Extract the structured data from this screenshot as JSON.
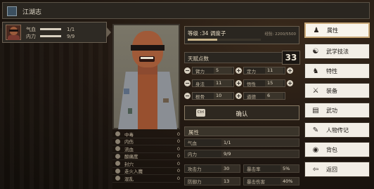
{
  "header": {
    "title": "江湖志"
  },
  "character_card": {
    "stats": [
      {
        "label": "气血",
        "value": "1/1"
      },
      {
        "label": "内力",
        "value": "9/9"
      }
    ]
  },
  "status_effects": [
    {
      "label": "中毒",
      "value": "0"
    },
    {
      "label": "内伤",
      "value": "0"
    },
    {
      "label": "流血",
      "value": "0"
    },
    {
      "label": "酸痛度",
      "value": "0"
    },
    {
      "label": "封穴",
      "value": "0"
    },
    {
      "label": "走火入魔",
      "value": "0"
    },
    {
      "label": "混乱",
      "value": "0"
    }
  ],
  "info": {
    "level": "等级 :34  调度子",
    "exp": "经验: 2200/5500",
    "exp_progress": 0.4
  },
  "talent": {
    "label": "天赋点数",
    "value": "33"
  },
  "attributes": [
    {
      "name": "臂力",
      "value": "5"
    },
    {
      "name": "定力",
      "value": "11"
    },
    {
      "name": "身法",
      "value": "11"
    },
    {
      "name": "悟性",
      "value": "15"
    },
    {
      "name": "根骨",
      "value": "10"
    },
    {
      "name": "道德",
      "value": "6"
    }
  ],
  "confirm": {
    "icon": "Ctrl",
    "label": "确认"
  },
  "section": {
    "title": "属性"
  },
  "stats_table": {
    "hp": {
      "name": "气血",
      "value": "1/1"
    },
    "mp": {
      "name": "内力",
      "value": "9/9"
    },
    "attack": {
      "name": "攻击力",
      "value": "30"
    },
    "crit": {
      "name": "暴击率",
      "value": "5%"
    },
    "defense": {
      "name": "防御力",
      "value": "13"
    },
    "crit_dmg": {
      "name": "暴击伤害",
      "value": "40%"
    }
  },
  "menu": [
    {
      "label": "属性",
      "icon": "person-icon",
      "glyph": "♟"
    },
    {
      "label": "武学技法",
      "icon": "martial-icon",
      "glyph": "☯"
    },
    {
      "label": "特性",
      "icon": "trait-icon",
      "glyph": "♞"
    },
    {
      "label": "装备",
      "icon": "sword-icon",
      "glyph": "⚔"
    },
    {
      "label": "武功",
      "icon": "book-icon",
      "glyph": "▤"
    },
    {
      "label": "人物传记",
      "icon": "scroll-icon",
      "glyph": "✎"
    },
    {
      "label": "背包",
      "icon": "bag-icon",
      "glyph": "◉"
    },
    {
      "label": "返回",
      "icon": "back-icon",
      "glyph": "⇦"
    }
  ]
}
